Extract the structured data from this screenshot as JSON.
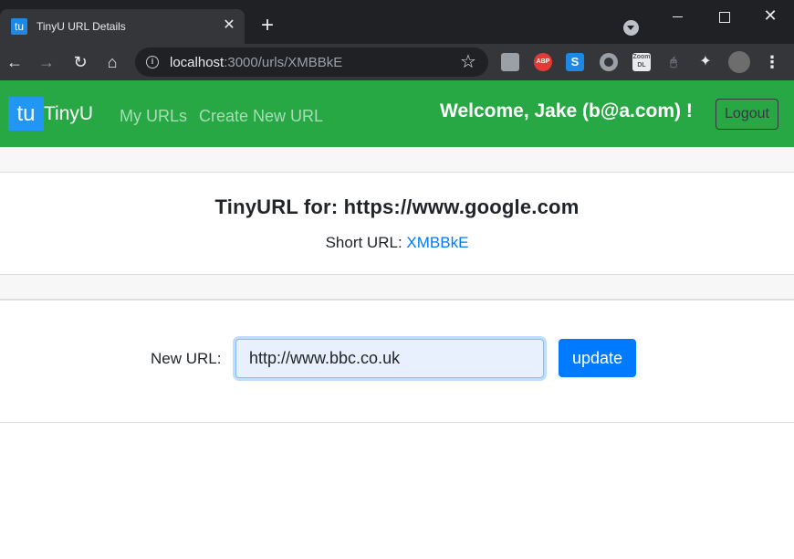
{
  "browser": {
    "tab": {
      "favicon": "tu",
      "title": "TinyU URL Details",
      "close": "✕"
    },
    "new_tab": "+",
    "window": {
      "minimize": "",
      "maximize": "",
      "close": "✕"
    },
    "nav": {
      "back": "←",
      "forward": "→",
      "reload": "↻",
      "home": "⌂"
    },
    "url": {
      "host": "localhost",
      "path": ":3000/urls/XMBBkE"
    },
    "star": "☆",
    "extensions": [
      "",
      "ABP",
      "S",
      "",
      "Zoom DL",
      "🖰",
      "✦",
      ""
    ],
    "menu": "⋮"
  },
  "app": {
    "brand": {
      "logo": "tu",
      "name": "TinyU"
    },
    "nav_links": [
      "My URLs",
      "Create New URL"
    ],
    "welcome": "Welcome, Jake (b@a.com) !",
    "logout_label": "Logout"
  },
  "details": {
    "title": "TinyURL for: https://www.google.com",
    "short_url_label": "Short URL: ",
    "short_url_value": "XMBBkE"
  },
  "form": {
    "label": "New URL:",
    "input_value": "http://www.bbc.co.uk",
    "submit_label": "update"
  },
  "colors": {
    "navbar": "#28a745",
    "brand_logo": "#2196f3",
    "primary": "#007bff",
    "link": "#007bff"
  }
}
